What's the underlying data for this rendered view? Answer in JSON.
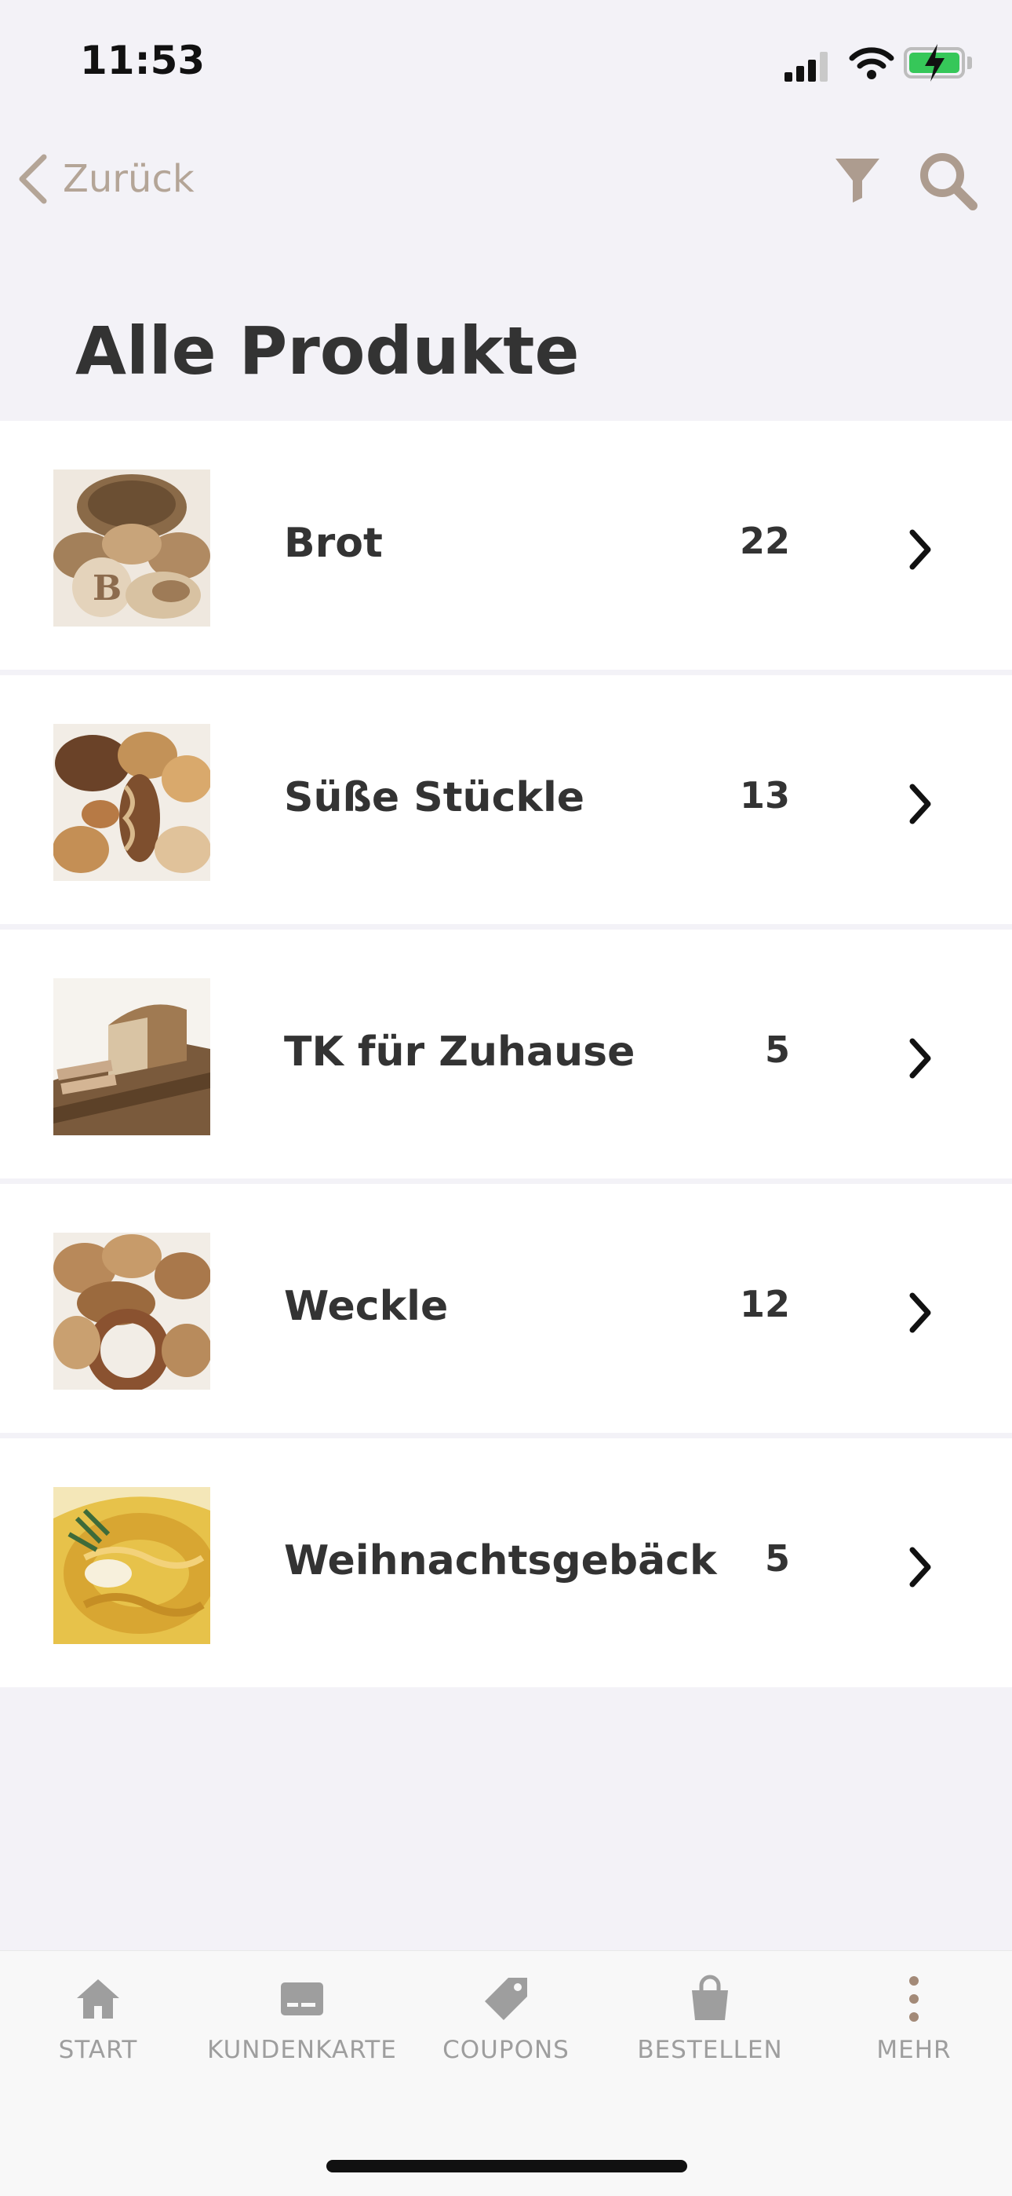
{
  "status": {
    "time": "11:53"
  },
  "nav": {
    "back_label": "Zurück"
  },
  "page": {
    "title": "Alle Produkte"
  },
  "categories": [
    {
      "label": "Brot",
      "count": "22"
    },
    {
      "label": "Süße Stückle",
      "count": "13"
    },
    {
      "label": "TK für Zuhause",
      "count": "5"
    },
    {
      "label": "Weckle",
      "count": "12"
    },
    {
      "label": "Weihnachtsgebäck",
      "count": "5"
    }
  ],
  "tabs": [
    {
      "label": "START",
      "icon": "home-icon"
    },
    {
      "label": "KUNDENKARTE",
      "icon": "card-icon"
    },
    {
      "label": "COUPONS",
      "icon": "tag-icon"
    },
    {
      "label": "BESTELLEN",
      "icon": "bag-icon"
    },
    {
      "label": "MEHR",
      "icon": "more-icon"
    }
  ],
  "colors": {
    "accent": "#b4a597",
    "tab_inactive": "#9e9e9e",
    "background": "#f3f2f7"
  }
}
